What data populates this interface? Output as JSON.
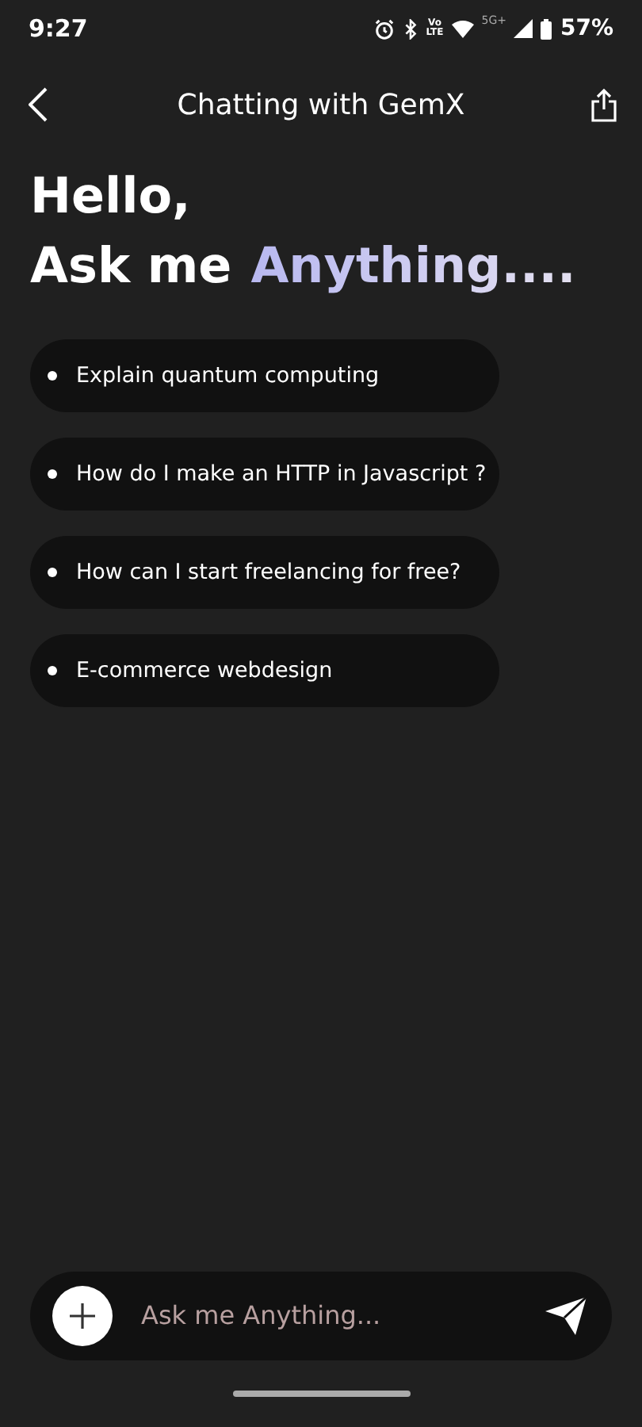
{
  "status_bar": {
    "time": "9:27",
    "volte_top": "Vo",
    "volte_bottom": "LTE",
    "network": "5G+",
    "battery": "57%"
  },
  "header": {
    "title": "Chatting with GemX"
  },
  "greeting": {
    "line1": "Hello,",
    "line2_plain": "Ask me",
    "line2_highlight": "Anything...."
  },
  "suggestions": [
    {
      "text": "Explain quantum computing"
    },
    {
      "text": "How do I make an HTTP in Javascript ?"
    },
    {
      "text": "How can I start freelancing for free?"
    },
    {
      "text": "E-commerce webdesign"
    }
  ],
  "composer": {
    "placeholder": "Ask me Anything..."
  }
}
